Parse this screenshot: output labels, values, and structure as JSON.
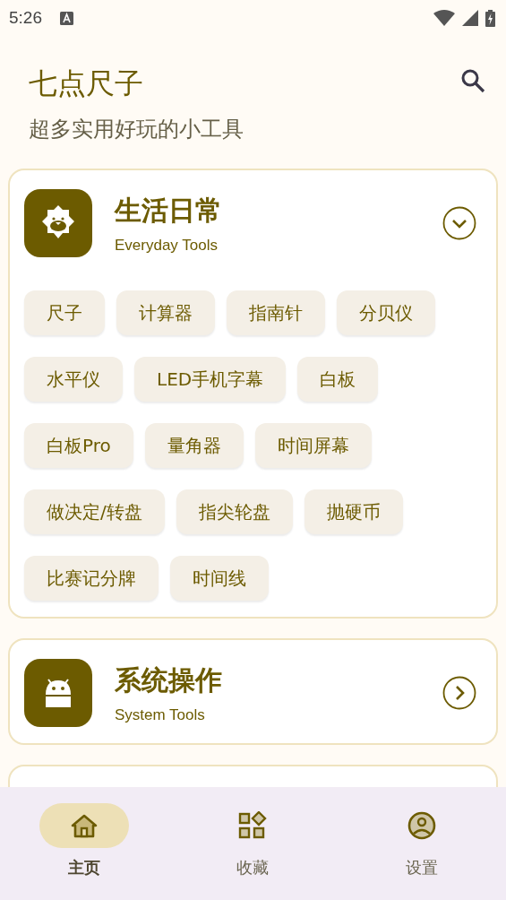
{
  "status_bar": {
    "time": "5:26"
  },
  "header": {
    "title": "七点尺子",
    "subtitle": "超多实用好玩的小工具"
  },
  "categories": [
    {
      "title": "生活日常",
      "subtitle": "Everyday Tools",
      "expanded": true,
      "tools": [
        "尺子",
        "计算器",
        "指南针",
        "分贝仪",
        "水平仪",
        "LED手机字幕",
        "白板",
        "白板Pro",
        "量角器",
        "时间屏幕",
        "做决定/转盘",
        "指尖轮盘",
        "抛硬币",
        "比赛记分牌",
        "时间线"
      ]
    },
    {
      "title": "系统操作",
      "subtitle": "System Tools",
      "expanded": false
    }
  ],
  "nav": [
    {
      "label": "主页",
      "selected": true
    },
    {
      "label": "收藏",
      "selected": false
    },
    {
      "label": "设置",
      "selected": false
    }
  ]
}
